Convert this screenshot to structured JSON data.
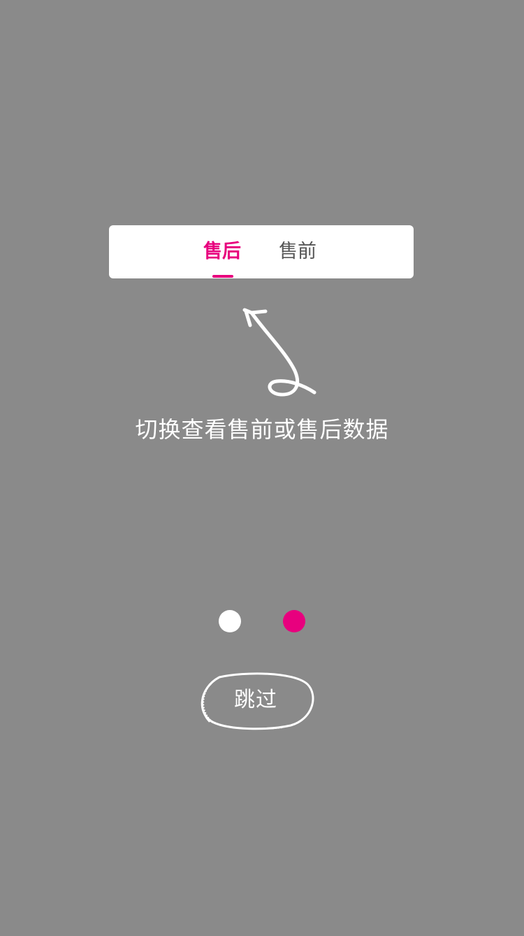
{
  "tabs": [
    {
      "label": "售后",
      "active": true
    },
    {
      "label": "售前",
      "active": false
    }
  ],
  "hint": {
    "text": "切换查看售前或售后数据"
  },
  "pagination": {
    "current": 2,
    "total": 2
  },
  "skip_button": {
    "label": "跳过"
  },
  "colors": {
    "overlay": "#8a8a8a",
    "accent": "#e8007e",
    "inactive_tab_text": "#555555",
    "dot_inactive": "#ffffff",
    "dot_active": "#e8007e",
    "card_background": "#ffffff"
  },
  "icons": {
    "guide_arrow": "hand-drawn-arrow-icon",
    "skip_outline": "hand-drawn-oval-outline"
  }
}
